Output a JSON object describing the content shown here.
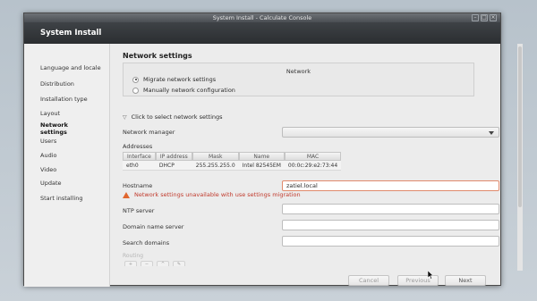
{
  "window": {
    "title": "System Install - Calculate Console",
    "controls": [
      "minimize-icon",
      "restore-icon",
      "close-icon"
    ]
  },
  "header": {
    "title": "System Install"
  },
  "sidebar": {
    "items": [
      {
        "label": "Language and locale",
        "active": false
      },
      {
        "label": "Distribution",
        "active": false
      },
      {
        "label": "Installation type",
        "active": false
      },
      {
        "label": "Layout",
        "active": false
      },
      {
        "label": "Network settings",
        "active": true
      },
      {
        "label": "Users",
        "active": false
      },
      {
        "label": "Audio",
        "active": false
      },
      {
        "label": "Video",
        "active": false
      },
      {
        "label": "Update",
        "active": false
      },
      {
        "label": "Start installing",
        "active": false
      }
    ]
  },
  "main": {
    "section_title": "Network settings",
    "network_group": {
      "title": "Network",
      "options": [
        {
          "label": "Migrate network settings",
          "checked": true
        },
        {
          "label": "Manually network configuration",
          "checked": false
        }
      ]
    },
    "expander_label": "Click to select network settings",
    "network_manager": {
      "label": "Network manager",
      "value": ""
    },
    "addresses": {
      "label": "Addresses",
      "columns": [
        "Interface",
        "IP address",
        "Mask",
        "Name",
        "MAC"
      ],
      "rows": [
        [
          "eth0",
          "DHCP",
          "255.255.255.0",
          "Intel 82545EM",
          "00:0c:29:e2:73:44"
        ]
      ]
    },
    "hostname": {
      "label": "Hostname",
      "value": "zatiel.local"
    },
    "warning": "Network settings unavailable with use settings migration",
    "ntp": {
      "label": "NTP server",
      "value": ""
    },
    "dns": {
      "label": "Domain name server",
      "value": ""
    },
    "search": {
      "label": "Search domains",
      "value": ""
    },
    "routing_label": "Routing"
  },
  "buttons": {
    "cancel": "Cancel",
    "previous": "Previous",
    "next": "Next"
  },
  "colors": {
    "header_bg": "#2b2e31",
    "warning": "#c0392b",
    "error_border": "#e08a6c"
  }
}
